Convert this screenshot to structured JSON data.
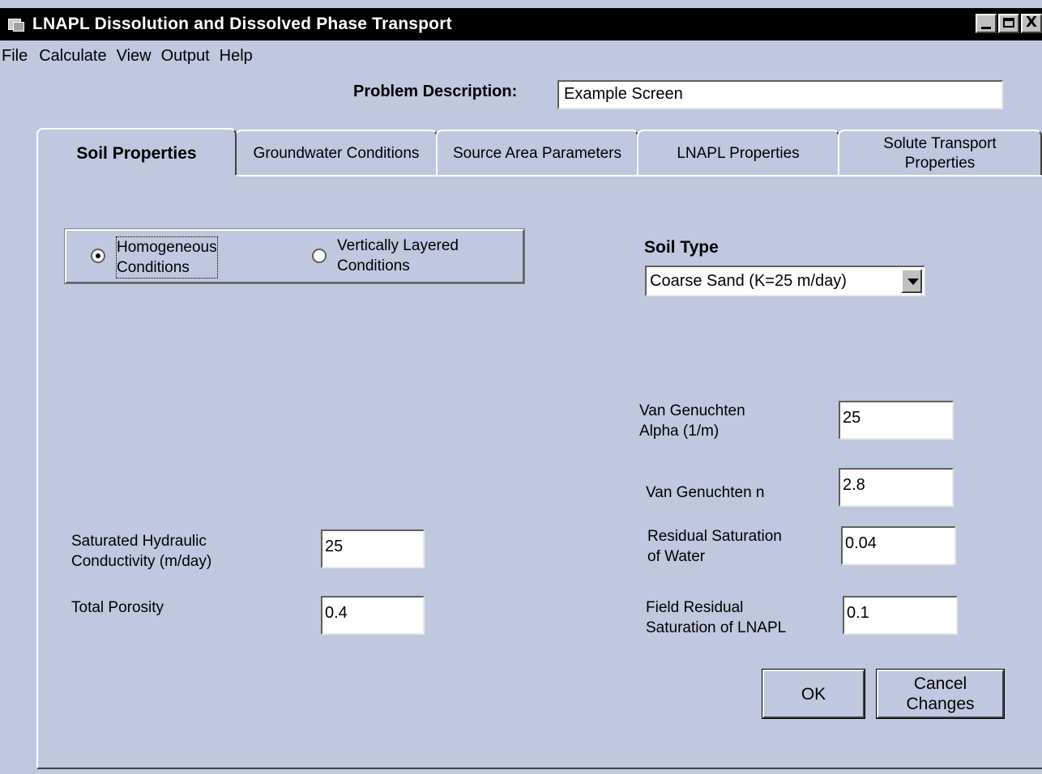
{
  "window": {
    "title": "LNAPL Dissolution and Dissolved Phase Transport",
    "buttons": {
      "minimize": "_",
      "maximize": "□",
      "close": "X"
    }
  },
  "menu": [
    "File",
    "Calculate",
    "View",
    "Output",
    "Help"
  ],
  "problem": {
    "label": "Problem Description:",
    "value": "Example Screen"
  },
  "tabs": [
    {
      "label": "Soil Properties",
      "active": true
    },
    {
      "label": "Groundwater Conditions"
    },
    {
      "label": "Source Area Parameters"
    },
    {
      "label": "LNAPL Properties"
    },
    {
      "label": "Solute Transport Properties"
    }
  ],
  "conditions": {
    "homogeneous": {
      "line1": "Homogeneous",
      "line2": "Conditions",
      "selected": true
    },
    "layered": {
      "line1": "Vertically Layered",
      "line2": "Conditions",
      "selected": false
    }
  },
  "soil_type": {
    "label": "Soil Type",
    "selected": "Coarse Sand (K=25 m/day)"
  },
  "fields": {
    "vg_alpha": {
      "line1": "Van Genuchten",
      "line2": "Alpha (1/m)",
      "value": "25"
    },
    "vg_n": {
      "label": "Van Genuchten n",
      "value": "2.8"
    },
    "sat_k": {
      "line1": "Saturated Hydraulic",
      "line2": "Conductivity (m/day)",
      "value": "25"
    },
    "residual_water": {
      "line1": "Residual Saturation",
      "line2": "of Water",
      "value": "0.04"
    },
    "porosity": {
      "label": "Total Porosity",
      "value": "0.4"
    },
    "residual_lnapl": {
      "line1": "Field Residual",
      "line2": "Saturation of LNAPL",
      "value": "0.1"
    }
  },
  "buttons": {
    "ok": "OK",
    "cancel_line1": "Cancel",
    "cancel_line2": "Changes"
  }
}
